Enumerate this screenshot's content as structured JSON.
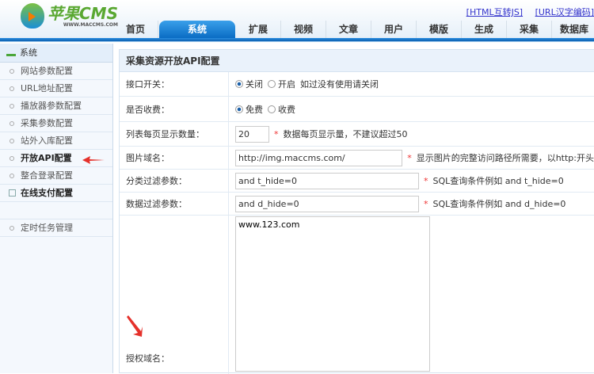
{
  "logo": {
    "name": "苹果CMS",
    "url": "WWW.MACCMS.COM"
  },
  "top_links": [
    "[HTML互转JS]",
    "[URL汉字编码]"
  ],
  "tabs": [
    "首页",
    "系统",
    "扩展",
    "视频",
    "文章",
    "用户",
    "模版",
    "生成",
    "采集",
    "数据库"
  ],
  "active_tab": "系统",
  "sidebar": {
    "title": "系统",
    "items": [
      "网站参数配置",
      "URL地址配置",
      "播放器参数配置",
      "采集参数配置",
      "站外入库配置",
      "开放API配置",
      "整合登录配置",
      "在线支付配置",
      "定时任务管理"
    ]
  },
  "form": {
    "title": "采集资源开放API配置",
    "switch": {
      "label": "接口开关：",
      "opt1": "关闭",
      "opt2": "开启",
      "hint": "如过没有使用请关闭"
    },
    "charge": {
      "label": "是否收费：",
      "opt1": "免费",
      "opt2": "收费"
    },
    "pagesize": {
      "label": "列表每页显示数量：",
      "value": "20",
      "hint": "数据每页显示量，不建议超过50"
    },
    "imgdomain": {
      "label": "图片域名：",
      "value": "http://img.maccms.com/",
      "hint": "显示图片的完整访问路径所需要，以http:开头"
    },
    "typefilter": {
      "label": "分类过滤参数：",
      "value": "and t_hide=0",
      "hint": "SQL查询条件例如 and t_hide=0"
    },
    "datafilter": {
      "label": "数据过滤参数：",
      "value": "and d_hide=0",
      "hint": "SQL查询条件例如 and d_hide=0"
    },
    "authdomain": {
      "label": "授权域名：",
      "value": "www.123.com"
    }
  }
}
